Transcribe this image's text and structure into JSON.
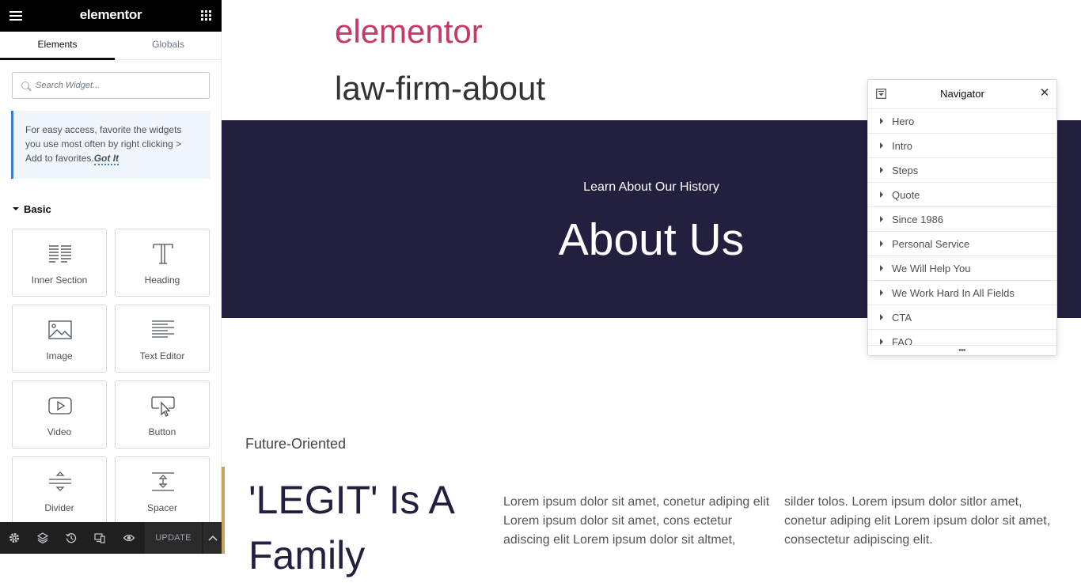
{
  "panel": {
    "logo": "elementor",
    "tabs": [
      {
        "label": "Elements",
        "active": true
      },
      {
        "label": "Globals",
        "active": false
      }
    ],
    "search": {
      "placeholder": "Search Widget..."
    },
    "tip": {
      "text": "For easy access, favorite the widgets you use most often by right clicking > Add to favorites.",
      "link": "Got It"
    },
    "section_title": "Basic",
    "widgets": [
      {
        "label": "Inner Section",
        "icon": "inner-section-icon"
      },
      {
        "label": "Heading",
        "icon": "heading-icon"
      },
      {
        "label": "Image",
        "icon": "image-icon"
      },
      {
        "label": "Text Editor",
        "icon": "text-editor-icon"
      },
      {
        "label": "Video",
        "icon": "video-icon"
      },
      {
        "label": "Button",
        "icon": "button-icon"
      },
      {
        "label": "Divider",
        "icon": "divider-icon"
      },
      {
        "label": "Spacer",
        "icon": "spacer-icon"
      }
    ],
    "footer": {
      "icons": [
        "settings-icon",
        "layers-icon",
        "history-icon",
        "responsive-icon",
        "preview-icon"
      ],
      "update_label": "UPDATE"
    }
  },
  "canvas": {
    "site_name": "elementor",
    "page_title": "law-firm-about",
    "hero": {
      "subtitle": "Learn About Our History",
      "title": "About Us",
      "background": "#221f3f"
    },
    "intro": {
      "subtitle": "Future-Oriented",
      "title": "'LEGIT' Is A Family",
      "col1": "Lorem ipsum dolor sit amet, conetur adiping elit Lorem ipsum dolor sit amet, cons ectetur adiscing elit Lorem ipsum dolor sit altmet,",
      "col2": "silder tolos. Lorem ipsum dolor sitlor amet, conetur adiping elit Lorem ipsum dolor sit amet, consectetur adipiscing elit."
    }
  },
  "navigator": {
    "title": "Navigator",
    "items": [
      "Hero",
      "Intro",
      "Steps",
      "Quote",
      "Since 1986",
      "Personal Service",
      "We Will Help You",
      "We Work Hard In All Fields",
      "CTA",
      "FAQ"
    ]
  },
  "colors": {
    "accent_pink": "#c6396a",
    "hero_navy": "#221f3f",
    "gold_bar": "#c9a45c",
    "tip_border": "#3b7bd8"
  }
}
